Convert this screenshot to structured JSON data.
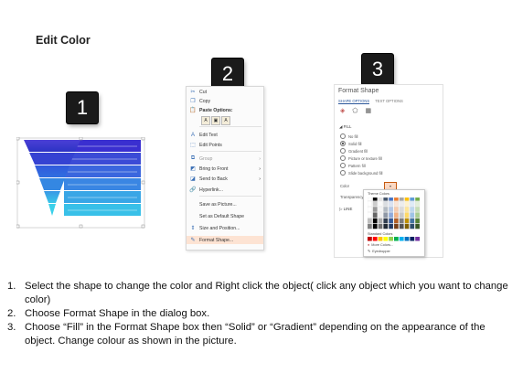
{
  "title": "Edit Color",
  "badges": [
    "1",
    "2",
    "3"
  ],
  "colors": {
    "funnel_dark": "#2e35c8",
    "funnel_mid": "#2f6fe0",
    "funnel_light": "#39c6e8",
    "menu_highlight": "#fde3d3",
    "link_blue": "#2b579a"
  },
  "context_menu": {
    "items": [
      {
        "icon": "cut-icon",
        "label": "Cut"
      },
      {
        "icon": "copy-icon",
        "label": "Copy"
      },
      {
        "icon": "paste-icon",
        "label": "Paste Options:"
      },
      {
        "icon": "edit-text-icon",
        "label": "Edit Text"
      },
      {
        "icon": "edit-points-icon",
        "label": "Edit Points"
      },
      {
        "icon": "group-icon",
        "label": "Group"
      },
      {
        "icon": "bring-to-front-icon",
        "label": "Bring to Front"
      },
      {
        "icon": "send-to-back-icon",
        "label": "Send to Back"
      },
      {
        "icon": "hyperlink-icon",
        "label": "Hyperlink..."
      },
      {
        "icon": "",
        "label": "Save as Picture..."
      },
      {
        "icon": "",
        "label": "Set as Default Shape"
      },
      {
        "icon": "size-position-icon",
        "label": "Size and Position..."
      },
      {
        "icon": "format-shape-icon",
        "label": "Format Shape..."
      }
    ]
  },
  "format_pane": {
    "title": "Format Shape",
    "tabs": [
      "SHAPE OPTIONS",
      "TEXT OPTIONS"
    ],
    "fill_header": "FILL",
    "fill_options": [
      "No fill",
      "Solid fill",
      "Gradient fill",
      "Picture or texture fill",
      "Pattern fill",
      "Slide background fill"
    ],
    "color_label": "Color",
    "transparency_label": "Transparency",
    "line_header": "LINE"
  },
  "palette": {
    "theme_title": "Theme Colors",
    "standard_title": "Standard Colors",
    "more_colors": "More Colors...",
    "eyedropper": "Eyedropper",
    "theme_top": [
      "#ffffff",
      "#000000",
      "#e7e6e6",
      "#44546a",
      "#4472c4",
      "#ed7d31",
      "#a5a5a5",
      "#ffc000",
      "#5b9bd5",
      "#70ad47"
    ],
    "standard": [
      "#c00000",
      "#ff0000",
      "#ffc000",
      "#ffff00",
      "#92d050",
      "#00b050",
      "#00b0f0",
      "#0070c0",
      "#002060",
      "#7030a0"
    ]
  },
  "instructions": [
    {
      "num": "1.",
      "text": "Select the shape to change the color and Right click the object( click any object which you want to change color)"
    },
    {
      "num": "2.",
      "text": "Choose Format Shape in the dialog box."
    },
    {
      "num": "3.",
      "text": "Choose “Fill” in the Format Shape box then “Solid” or “Gradient” depending on the appearance of the object. Change colour as shown in the picture."
    }
  ]
}
